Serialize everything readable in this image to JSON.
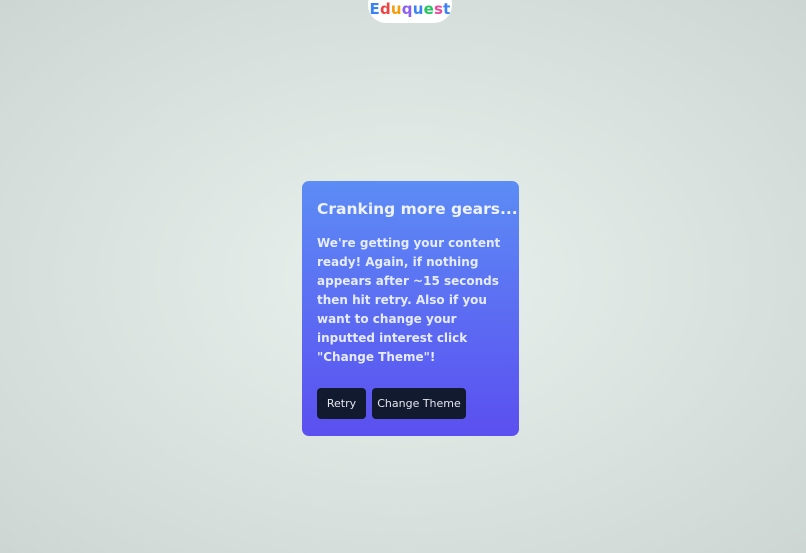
{
  "logo": {
    "letters": [
      {
        "char": "E",
        "color": "#3b82f6"
      },
      {
        "char": "d",
        "color": "#ef4444"
      },
      {
        "char": "u",
        "color": "#f59e0b"
      },
      {
        "char": "q",
        "color": "#8b5cf6"
      },
      {
        "char": "u",
        "color": "#3b82f6"
      },
      {
        "char": "e",
        "color": "#22c55e"
      },
      {
        "char": "s",
        "color": "#ec4899"
      },
      {
        "char": "t",
        "color": "#3b82f6"
      }
    ]
  },
  "dialog": {
    "title": "Cranking more gears...",
    "message": "We're getting your content ready! Again, if nothing appears after ~15 seconds then hit retry. Also if you want to change your inputted interest click \"Change Theme\"!",
    "retry_label": "Retry",
    "change_theme_label": "Change Theme"
  },
  "colors": {
    "card_top": "#5c8cf5",
    "card_bottom": "#5b4ff0",
    "button_bg": "#111a2e"
  }
}
